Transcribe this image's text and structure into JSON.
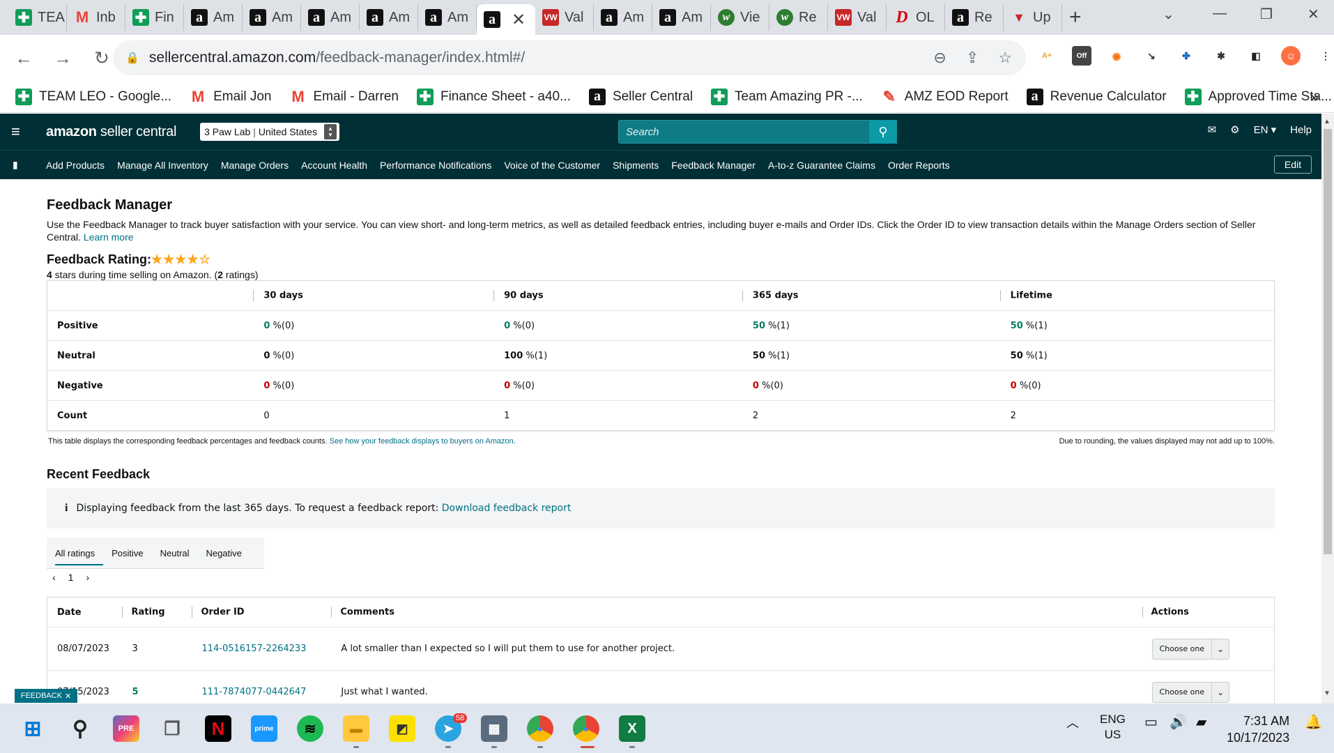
{
  "browser": {
    "tabs": [
      {
        "icon": "sheets",
        "label": "TEA"
      },
      {
        "icon": "gmail",
        "label": "Inb"
      },
      {
        "icon": "sheets",
        "label": "Fin"
      },
      {
        "icon": "amazon",
        "label": "Am"
      },
      {
        "icon": "amazon",
        "label": "Am"
      },
      {
        "icon": "amazon",
        "label": "Am"
      },
      {
        "icon": "amazon",
        "label": "Am"
      },
      {
        "icon": "amazon",
        "label": "Am"
      },
      {
        "icon": "amazon",
        "label": ""
      },
      {
        "icon": "vw",
        "label": "Val"
      },
      {
        "icon": "amazon",
        "label": "Am"
      },
      {
        "icon": "amazon",
        "label": "Am"
      },
      {
        "icon": "w",
        "label": "Vie"
      },
      {
        "icon": "w",
        "label": "Re"
      },
      {
        "icon": "vw",
        "label": "Val"
      },
      {
        "icon": "d",
        "label": "OL"
      },
      {
        "icon": "amazon",
        "label": "Re"
      },
      {
        "icon": "up",
        "label": "Up"
      }
    ],
    "active_tab_index": 8,
    "url_host": "sellercentral.amazon.com",
    "url_path": "/feedback-manager/index.html#/",
    "bookmarks": [
      {
        "icon": "sheets",
        "label": "TEAM LEO - Google..."
      },
      {
        "icon": "gmail",
        "label": "Email Jon"
      },
      {
        "icon": "gmail",
        "label": "Email - Darren"
      },
      {
        "icon": "sheets",
        "label": "Finance Sheet - a40..."
      },
      {
        "icon": "amazon",
        "label": "Seller Central"
      },
      {
        "icon": "sheets",
        "label": "Team Amazing PR -..."
      },
      {
        "icon": "amz",
        "label": "AMZ EOD Report"
      },
      {
        "icon": "amazon",
        "label": "Revenue Calculator"
      },
      {
        "icon": "sheets",
        "label": "Approved Time Sta..."
      }
    ],
    "more": "»"
  },
  "header": {
    "logo_bold": "amazon",
    "logo_rest": " seller central",
    "store": "3 Paw Lab",
    "country": "United States",
    "search_placeholder": "Search",
    "language": "EN",
    "help": "Help"
  },
  "nav": {
    "links": [
      "Add Products",
      "Manage All Inventory",
      "Manage Orders",
      "Account Health",
      "Performance Notifications",
      "Voice of the Customer",
      "Shipments",
      "Feedback Manager",
      "A-to-z Guarantee Claims",
      "Order Reports"
    ],
    "edit": "Edit"
  },
  "page": {
    "title": "Feedback Manager",
    "description": "Use the Feedback Manager to track buyer satisfaction with your service. You can view short- and long-term metrics, as well as detailed feedback entries, including buyer e-mails and Order IDs. Click the Order ID to view transaction details within the Manage Orders section of Seller Central.",
    "learn_more": "Learn more",
    "rating_label": "Feedback Rating:",
    "rating_stars": 4,
    "rating_sub_stars": "4",
    "rating_sub_mid": " stars during time selling on Amazon. (",
    "rating_sub_count": "2",
    "rating_sub_end": " ratings)"
  },
  "summary": {
    "columns": [
      "30 days",
      "90 days",
      "365 days",
      "Lifetime"
    ],
    "rows": [
      {
        "label": "Positive",
        "cells": [
          {
            "v": "0",
            "rest": " %(0)"
          },
          {
            "v": "0",
            "rest": " %(0)"
          },
          {
            "v": "50",
            "rest": " %(1)"
          },
          {
            "v": "50",
            "rest": " %(1)"
          }
        ]
      },
      {
        "label": "Neutral",
        "cells": [
          {
            "v": "0",
            "rest": " %(0)"
          },
          {
            "v": "100",
            "rest": " %(1)"
          },
          {
            "v": "50",
            "rest": " %(1)"
          },
          {
            "v": "50",
            "rest": " %(1)"
          }
        ]
      },
      {
        "label": "Negative",
        "cells": [
          {
            "v": "0",
            "rest": " %(0)"
          },
          {
            "v": "0",
            "rest": " %(0)"
          },
          {
            "v": "0",
            "rest": " %(0)"
          },
          {
            "v": "0",
            "rest": " %(0)"
          }
        ]
      },
      {
        "label": "Count",
        "cells": [
          {
            "v": "",
            "rest": "0"
          },
          {
            "v": "",
            "rest": "1"
          },
          {
            "v": "",
            "rest": "2"
          },
          {
            "v": "",
            "rest": "2"
          }
        ]
      }
    ],
    "note": "This table displays the corresponding feedback percentages and feedback counts.",
    "note_link": "See how your feedback displays to buyers on Amazon.",
    "note_right": "Due to rounding, the values displayed may not add up to 100%."
  },
  "recent": {
    "title": "Recent Feedback",
    "info_icon": "i",
    "info": "Displaying feedback from the last 365 days. To request a feedback report:",
    "info_link": "Download feedback report",
    "tabs": [
      "All ratings",
      "Positive",
      "Neutral",
      "Negative"
    ],
    "page": "1",
    "columns": [
      "Date",
      "Rating",
      "Order ID",
      "Comments",
      "Actions"
    ],
    "rows": [
      {
        "date": "08/07/2023",
        "rating": "3",
        "order_id": "114-0516157-2264233",
        "comment": "A lot smaller than I expected so I will put them to use for another project.",
        "action": "Choose one"
      },
      {
        "date": "07/15/2023",
        "rating": "5",
        "order_id": "111-7874077-0442647",
        "comment": "Just what I wanted.",
        "action": "Choose one"
      }
    ],
    "feedback_tab": "FEEDBACK"
  },
  "taskbar": {
    "telegram_badge": "58",
    "lang1": "ENG",
    "lang2": "US",
    "time": "7:31 AM",
    "date": "10/17/2023"
  },
  "colors": {
    "header_bg": "#002f36",
    "link": "#007185",
    "positive": "#067d62",
    "negative": "#c40000",
    "star": "#ffa41c"
  }
}
